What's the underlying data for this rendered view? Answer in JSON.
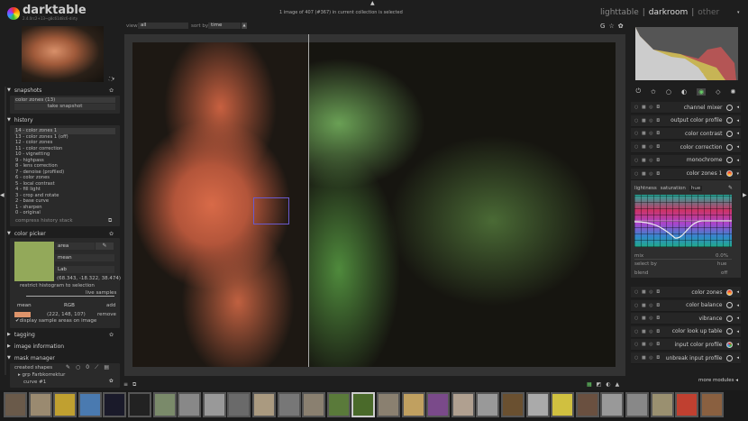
{
  "app": {
    "name": "darktable",
    "version": "2.4.0rc2+13~g8c61d8c6-dirty"
  },
  "top": {
    "status": "1 image of 407 (#367) in current collection is selected",
    "views": [
      "lighttable",
      "darkroom",
      "other"
    ],
    "active_view": "darkroom",
    "separator": "|"
  },
  "toolbar": {
    "view_label": "view",
    "view_value": "all",
    "sort_label": "sort by",
    "sort_value": "time"
  },
  "snapshots": {
    "title": "snapshots",
    "item": "color zones (13)",
    "button": "take snapshot"
  },
  "history": {
    "title": "history",
    "items": [
      "14 - color zones 1",
      "13 - color zones 1 (off)",
      "12 - color zones",
      "11 - color correction",
      "10 - vignetting",
      "9 - highpass",
      "8 - lens correction",
      "7 - denoise (profiled)",
      "6 - color zones",
      "5 - local contrast",
      "4 - fill light",
      "3 - crop and rotate",
      "2 - base curve",
      "1 - sharpen",
      "0 - original"
    ],
    "compress": "compress history stack"
  },
  "color_picker": {
    "title": "color picker",
    "swatch_color": "#93a95a",
    "mode": "area",
    "stat": "mean",
    "space": "Lab",
    "values": "(68.343, -18.322, 38.474)",
    "restrict": "restrict histogram to selection",
    "live_samples": "live samples",
    "sample_stat": "mean",
    "sample_space": "RGB",
    "add": "add",
    "sample_color": "#de946b",
    "sample_values": "(222, 148, 107)",
    "remove": "remove",
    "display": "display sample areas on image"
  },
  "collapsed": {
    "tagging": "tagging",
    "image_information": "image information"
  },
  "mask_manager": {
    "title": "mask manager",
    "created_shapes": "created shapes",
    "group": "grp Farbkorrektur",
    "curve": "curve #1"
  },
  "histogram": {
    "exif": "1/640 f/4.0 102mm iso 100"
  },
  "modules": {
    "before": [
      "channel mixer",
      "output color profile",
      "color contrast",
      "color correction",
      "monochrome",
      "color zones 1"
    ],
    "color_zones_panel": {
      "tabs": [
        "lightness",
        "saturation",
        "hue"
      ],
      "active_tab": "hue",
      "mix_label": "mix",
      "mix_value": "0.0%",
      "select_by_label": "select by",
      "select_by_value": "hue",
      "blend_label": "blend",
      "blend_value": "off"
    },
    "after": [
      "color zones",
      "color balance",
      "vibrance",
      "color look up table",
      "input color profile",
      "unbreak input profile"
    ],
    "more": "more modules"
  },
  "filmstrip": {
    "thumbs": [
      "#6a5a4a",
      "#9a8a70",
      "#c0a030",
      "#4a7ab0",
      "#1a1a2a",
      "#222",
      "#7a8a6a",
      "#888",
      "#999",
      "#6a6a6a",
      "#aa9a80",
      "#777",
      "#8a8070",
      "#5a7a3a",
      "#4a6a2a",
      "#8a8070",
      "#c0a060",
      "#7a4a8a",
      "#b0a090",
      "#999",
      "#6a5030",
      "#aaa",
      "#d0c040",
      "#6a5040",
      "#999",
      "#888",
      "#9a9070",
      "#c04030",
      "#8a6040"
    ],
    "selected_index": 14
  }
}
